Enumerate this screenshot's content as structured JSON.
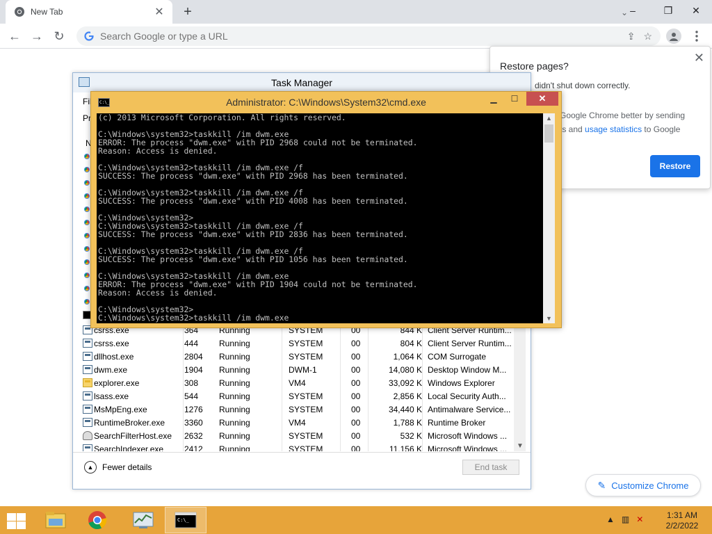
{
  "chrome": {
    "tab_title": "New Tab",
    "omnibox_placeholder": "Search Google or type a URL",
    "restore_popup": {
      "title": "Restore pages?",
      "message": "didn't shut down correctly.",
      "help_line1": "Google Chrome better by sending",
      "help_line2_prefix": "ts and ",
      "help_link": "usage statistics",
      "help_line2_suffix": " to Google",
      "restore_label": "Restore"
    },
    "customize_label": "Customize Chrome"
  },
  "task_manager": {
    "title": "Task Manager",
    "menu_file": "Fil",
    "tab_processes": "Pr",
    "col_name": "N",
    "rows": [
      {
        "name": "csrss.exe",
        "pid": "364",
        "status": "Running",
        "user": "SYSTEM",
        "cpu": "00",
        "memory": "844 K",
        "description": "Client Server Runtim...",
        "icon": "app"
      },
      {
        "name": "csrss.exe",
        "pid": "444",
        "status": "Running",
        "user": "SYSTEM",
        "cpu": "00",
        "memory": "804 K",
        "description": "Client Server Runtim...",
        "icon": "app"
      },
      {
        "name": "dllhost.exe",
        "pid": "2804",
        "status": "Running",
        "user": "SYSTEM",
        "cpu": "00",
        "memory": "1,064 K",
        "description": "COM Surrogate",
        "icon": "app"
      },
      {
        "name": "dwm.exe",
        "pid": "1904",
        "status": "Running",
        "user": "DWM-1",
        "cpu": "00",
        "memory": "14,080 K",
        "description": "Desktop Window M...",
        "icon": "app"
      },
      {
        "name": "explorer.exe",
        "pid": "308",
        "status": "Running",
        "user": "VM4",
        "cpu": "00",
        "memory": "33,092 K",
        "description": "Windows Explorer",
        "icon": "folder"
      },
      {
        "name": "lsass.exe",
        "pid": "544",
        "status": "Running",
        "user": "SYSTEM",
        "cpu": "00",
        "memory": "2,856 K",
        "description": "Local Security Auth...",
        "icon": "app"
      },
      {
        "name": "MsMpEng.exe",
        "pid": "1276",
        "status": "Running",
        "user": "SYSTEM",
        "cpu": "00",
        "memory": "34,440 K",
        "description": "Antimalware Service...",
        "icon": "app"
      },
      {
        "name": "RuntimeBroker.exe",
        "pid": "3360",
        "status": "Running",
        "user": "VM4",
        "cpu": "00",
        "memory": "1,788 K",
        "description": "Runtime Broker",
        "icon": "app"
      },
      {
        "name": "SearchFilterHost.exe",
        "pid": "2632",
        "status": "Running",
        "user": "SYSTEM",
        "cpu": "00",
        "memory": "532 K",
        "description": "Microsoft Windows ...",
        "icon": "user"
      },
      {
        "name": "SearchIndexer.exe",
        "pid": "2412",
        "status": "Running",
        "user": "SYSTEM",
        "cpu": "00",
        "memory": "11,156 K",
        "description": "Microsoft Windows ...",
        "icon": "app"
      }
    ],
    "fewer_details": "Fewer details",
    "end_task": "End task"
  },
  "cmd": {
    "title": "Administrator: C:\\Windows\\System32\\cmd.exe",
    "icon_text": "C:\\_",
    "output": "(c) 2013 Microsoft Corporation. All rights reserved.\n\nC:\\Windows\\system32>taskkill /im dwm.exe\nERROR: The process \"dwm.exe\" with PID 2968 could not be terminated.\nReason: Access is denied.\n\nC:\\Windows\\system32>taskkill /im dwm.exe /f\nSUCCESS: The process \"dwm.exe\" with PID 2968 has been terminated.\n\nC:\\Windows\\system32>taskkill /im dwm.exe /f\nSUCCESS: The process \"dwm.exe\" with PID 4008 has been terminated.\n\nC:\\Windows\\system32>\nC:\\Windows\\system32>taskkill /im dwm.exe /f\nSUCCESS: The process \"dwm.exe\" with PID 2836 has been terminated.\n\nC:\\Windows\\system32>taskkill /im dwm.exe /f\nSUCCESS: The process \"dwm.exe\" with PID 1056 has been terminated.\n\nC:\\Windows\\system32>taskkill /im dwm.exe\nERROR: The process \"dwm.exe\" with PID 1904 could not be terminated.\nReason: Access is denied.\n\nC:\\Windows\\system32>\nC:\\Windows\\system32>taskkill /im dwm.exe"
  },
  "taskbar": {
    "time": "1:31 AM",
    "date": "2/2/2022"
  },
  "colors": {
    "taskbar": "#e7a43a",
    "cmd_frame": "#f2c15a",
    "chrome_blue": "#1a73e8",
    "close_red": "#c75050"
  }
}
